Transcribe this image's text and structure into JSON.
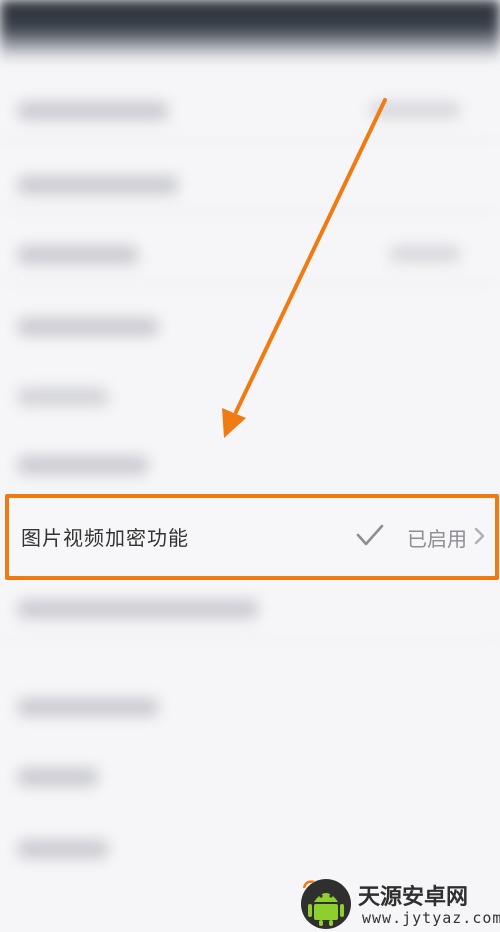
{
  "row": {
    "label": "图片视频加密功能",
    "status": "已启用",
    "check_icon": "check-icon",
    "chevron_icon": "chevron-right-icon"
  },
  "annotation": {
    "arrow_color": "#f07b12",
    "highlight_color": "#f07b12"
  },
  "watermark": {
    "name": "天源安卓网",
    "url": "www.jytyaz.com"
  }
}
